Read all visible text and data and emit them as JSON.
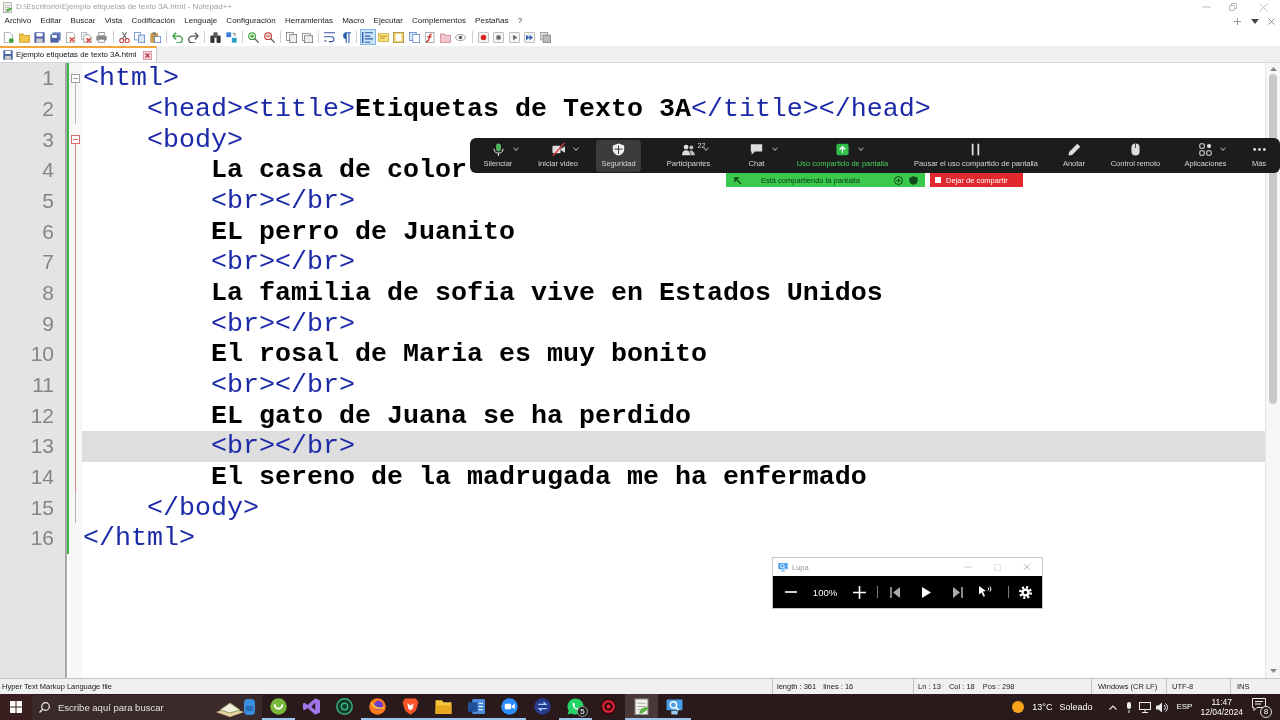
{
  "window": {
    "title": "D:\\Escritorio\\Ejemplo etiquetas de texto 3A.html - Notepad++"
  },
  "menu": [
    "Archivo",
    "Editar",
    "Buscar",
    "Vista",
    "Codificación",
    "Lenguaje",
    "Configuración",
    "Herramientas",
    "Macro",
    "Ejecutar",
    "Complementos",
    "Pestañas",
    "?"
  ],
  "toolbar": [
    [
      {
        "kind": "new",
        "on": false
      },
      {
        "kind": "open",
        "on": false
      },
      {
        "kind": "save",
        "on": false
      },
      {
        "kind": "save_all",
        "on": false
      },
      {
        "kind": "close",
        "on": false
      },
      {
        "kind": "close_all",
        "on": false
      },
      {
        "kind": "print",
        "on": false
      }
    ],
    [
      {
        "kind": "cut",
        "on": false
      },
      {
        "kind": "copy",
        "on": false
      },
      {
        "kind": "paste",
        "on": false
      }
    ],
    [
      {
        "kind": "undo",
        "on": false
      },
      {
        "kind": "redo",
        "on": false
      }
    ],
    [
      {
        "kind": "find",
        "on": false
      },
      {
        "kind": "replace",
        "on": false
      }
    ],
    [
      {
        "kind": "zoom_in",
        "on": false
      },
      {
        "kind": "zoom_out",
        "on": false
      }
    ],
    [
      {
        "kind": "sync_v",
        "on": false
      },
      {
        "kind": "sync_h",
        "on": false
      }
    ],
    [
      {
        "kind": "wrap",
        "on": false
      },
      {
        "kind": "all_chars",
        "on": false
      }
    ],
    [
      {
        "kind": "indent_guide",
        "on": true
      },
      {
        "kind": "udl",
        "on": false
      },
      {
        "kind": "doc_map",
        "on": false
      },
      {
        "kind": "doc_list",
        "on": false
      },
      {
        "kind": "function_list",
        "on": false
      },
      {
        "kind": "folder_workspace",
        "on": false
      },
      {
        "kind": "monitor",
        "on": false
      }
    ],
    [
      {
        "kind": "record",
        "on": false
      },
      {
        "kind": "stop",
        "on": false
      },
      {
        "kind": "play",
        "on": false
      },
      {
        "kind": "play_multi",
        "on": false
      },
      {
        "kind": "save_macro",
        "on": false
      }
    ]
  ],
  "tabs": [
    {
      "label": "Ejemplo etiquetas de texto 3A.html",
      "selected": true
    }
  ],
  "editor": {
    "lines": [
      {
        "number": "1",
        "segments": [
          {
            "kind": "tag",
            "text": "<html>"
          }
        ],
        "expanded": true,
        "active": false,
        "current": false,
        "children": [
          {
            "number": "2",
            "segments": [
              {
                "kind": "tag",
                "text": "<head><title>"
              },
              {
                "kind": "text",
                "text": "Etiquetas de Texto 3A"
              },
              {
                "kind": "tag",
                "text": "</title></head>"
              }
            ],
            "current": false
          },
          {
            "number": "3",
            "segments": [
              {
                "kind": "tag",
                "text": "<body>"
              }
            ],
            "expanded": true,
            "active": true,
            "current": false,
            "children": [
              {
                "number": "4",
                "segments": [
                  {
                    "kind": "text",
                    "text": "La casa de color"
                  }
                ],
                "current": false
              },
              {
                "number": "5",
                "segments": [
                  {
                    "kind": "tag",
                    "text": "<br></br>"
                  }
                ],
                "current": false
              },
              {
                "number": "6",
                "segments": [
                  {
                    "kind": "text",
                    "text": "EL perro de Juanito"
                  }
                ],
                "current": false
              },
              {
                "number": "7",
                "segments": [
                  {
                    "kind": "tag",
                    "text": "<br></br>"
                  }
                ],
                "current": false
              },
              {
                "number": "8",
                "segments": [
                  {
                    "kind": "text",
                    "text": "La familia de sofia vive en Estados Unidos"
                  }
                ],
                "current": false
              },
              {
                "number": "9",
                "segments": [
                  {
                    "kind": "tag",
                    "text": "<br></br>"
                  }
                ],
                "current": false
              },
              {
                "number": "10",
                "segments": [
                  {
                    "kind": "text",
                    "text": "El rosal de Maria es muy bonito"
                  }
                ],
                "current": false
              },
              {
                "number": "11",
                "segments": [
                  {
                    "kind": "tag",
                    "text": "<br></br>"
                  }
                ],
                "current": false
              },
              {
                "number": "12",
                "segments": [
                  {
                    "kind": "text",
                    "text": "EL gato de Juana se ha perdido"
                  }
                ],
                "current": false
              },
              {
                "number": "13",
                "segments": [
                  {
                    "kind": "tag",
                    "text": "<br></br>"
                  }
                ],
                "current": true
              },
              {
                "number": "14",
                "segments": [
                  {
                    "kind": "text",
                    "text": "El sereno de la madrugada me ha enfermado"
                  }
                ],
                "current": false
              }
            ]
          },
          {
            "number": "15",
            "segments": [
              {
                "kind": "tag",
                "text": "</body>"
              }
            ],
            "current": false
          }
        ]
      },
      {
        "number": "16",
        "segments": [
          {
            "kind": "tag",
            "text": "</html>"
          }
        ],
        "current": false
      }
    ]
  },
  "meeting_toolbar": {
    "items": [
      {
        "kind": "mic",
        "label": "Silenciar",
        "menu": true,
        "highlighted": false,
        "active": false
      },
      {
        "kind": "video_off",
        "label": "Iniciar video",
        "menu": true,
        "highlighted": false,
        "active": false
      },
      {
        "kind": "security",
        "label": "Seguridad",
        "menu": false,
        "highlighted": true,
        "active": false
      },
      {
        "kind": "participants",
        "label": "Participantes",
        "count": "22",
        "menu": true,
        "highlighted": false,
        "active": false
      },
      {
        "kind": "chat",
        "label": "Chat",
        "menu": true,
        "highlighted": false,
        "active": false
      },
      {
        "kind": "share",
        "label": "Uso compartido de pantalla",
        "menu": true,
        "highlighted": false,
        "active": true
      },
      {
        "kind": "pause",
        "label": "Pausar el uso compartido de pantalla",
        "menu": false,
        "highlighted": false,
        "active": false
      },
      {
        "kind": "annotate",
        "label": "Anotar",
        "menu": false,
        "highlighted": false,
        "active": false
      },
      {
        "kind": "remote",
        "label": "Control remoto",
        "menu": false,
        "highlighted": false,
        "active": false
      },
      {
        "kind": "apps",
        "label": "Aplicaciones",
        "menu": true,
        "highlighted": false,
        "active": false
      },
      {
        "kind": "more",
        "label": "Más",
        "menu": false,
        "highlighted": false,
        "active": false
      }
    ]
  },
  "share_banner": {
    "status": "Está compartiendo la pantalla",
    "stop_label": "Dejar de compartir"
  },
  "magnifier": {
    "title": "Lupa",
    "zoom": "100%"
  },
  "status_bar": {
    "file_type": "Hyper Text Markup Language file",
    "length": "length : 361",
    "lines": "lines : 16",
    "line": "Ln : 13",
    "column": "Col : 18",
    "position": "Pos : 298",
    "line_ending": "Windows (CR LF)",
    "encoding": "UTF-8",
    "mode": "INS"
  },
  "taskbar": {
    "search_placeholder": "Escribe aquí para buscar",
    "apps": [
      {
        "kind": "round_logo",
        "running": true,
        "active": false
      },
      {
        "kind": "ribbon",
        "running": false,
        "active": false
      },
      {
        "kind": "ring_logo",
        "running": false,
        "active": false
      },
      {
        "kind": "globe",
        "running": true,
        "active": false
      },
      {
        "kind": "shield",
        "running": true,
        "active": false
      },
      {
        "kind": "folder",
        "running": true,
        "active": false
      },
      {
        "kind": "document",
        "running": true,
        "active": false
      },
      {
        "kind": "video",
        "running": true,
        "active": false
      },
      {
        "kind": "arrows",
        "running": false,
        "active": false
      },
      {
        "kind": "phone_bubble",
        "running": true,
        "active": false,
        "badge": "5"
      },
      {
        "kind": "target",
        "running": false,
        "active": false
      },
      {
        "kind": "notepad",
        "running": true,
        "active": true
      },
      {
        "kind": "magnifier",
        "running": true,
        "active": false
      }
    ],
    "weather": {
      "temperature": "13°C",
      "condition": "Soleado"
    },
    "language": "ESP",
    "time": "11:47",
    "date": "12/04/2024",
    "notifications": "8"
  }
}
